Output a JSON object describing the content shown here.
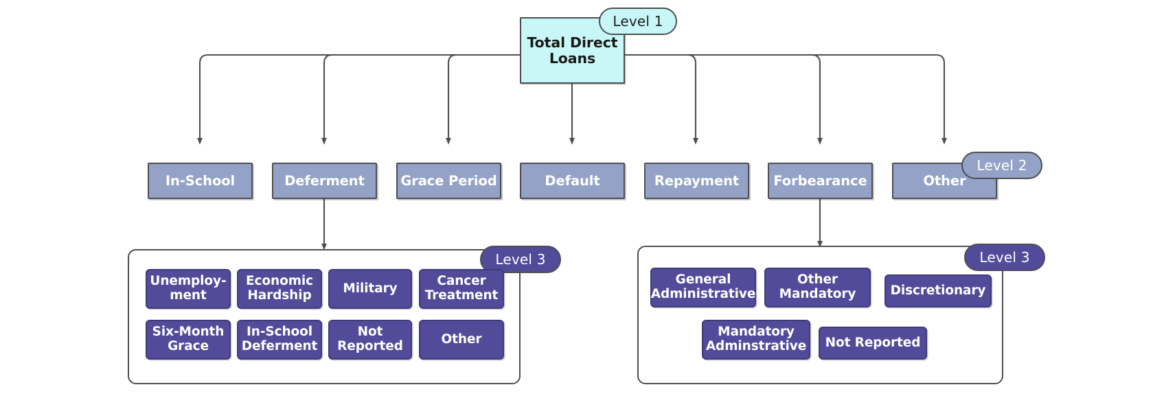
{
  "diagram": {
    "title": "Total Direct Loans hierarchy",
    "colors": {
      "level1_fill": "#c9f7f7",
      "level2_fill": "#93a2c6",
      "level3_fill": "#514b9a",
      "stroke": "#4d4d52",
      "background": "#ffffff",
      "level1_text": "#191919",
      "level2_text": "#ffffff",
      "level3_text": "#ffffff"
    },
    "badges": {
      "level1": "Level 1",
      "level2": "Level 2",
      "level3_left": "Level 3",
      "level3_right": "Level 3"
    },
    "root": {
      "line1": "Total Direct",
      "line2": "Loans"
    },
    "level2": [
      {
        "label": "In-School"
      },
      {
        "label": "Deferment"
      },
      {
        "label": "Grace Period"
      },
      {
        "label": "Default"
      },
      {
        "label": "Repayment"
      },
      {
        "label": "Forbearance"
      },
      {
        "label": "Other"
      }
    ],
    "level3_deferment": [
      {
        "line1": "Unemploy-",
        "line2": "ment"
      },
      {
        "line1": "Economic",
        "line2": "Hardship"
      },
      {
        "line1": "Military",
        "line2": ""
      },
      {
        "line1": "Cancer",
        "line2": "Treatment"
      },
      {
        "line1": "Six-Month",
        "line2": "Grace"
      },
      {
        "line1": "In-School",
        "line2": "Deferment"
      },
      {
        "line1": "Not",
        "line2": "Reported"
      },
      {
        "line1": "Other",
        "line2": ""
      }
    ],
    "level3_forbearance": [
      {
        "line1": "General",
        "line2": "Administrative"
      },
      {
        "line1": "Other",
        "line2": "Mandatory"
      },
      {
        "line1": "Discretionary",
        "line2": ""
      },
      {
        "line1": "Mandatory",
        "line2": "Adminstrative"
      },
      {
        "line1": "Not Reported",
        "line2": ""
      }
    ]
  }
}
